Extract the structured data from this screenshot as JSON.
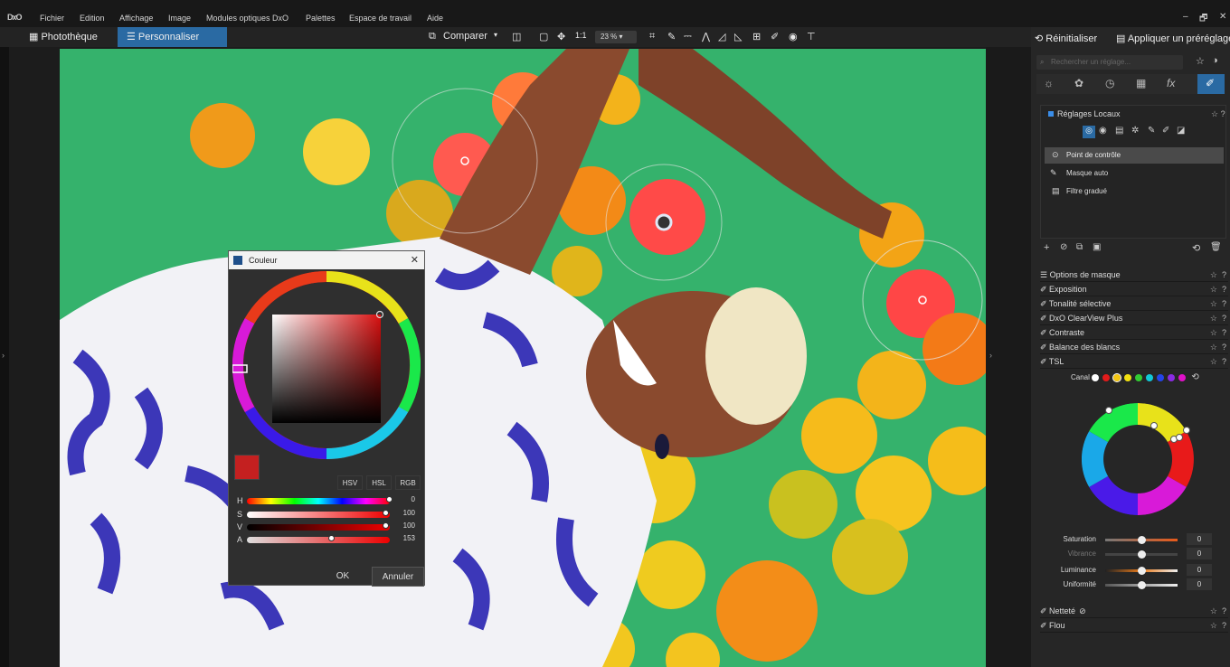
{
  "menubar": {
    "logo": "DxO",
    "items": [
      "Fichier",
      "Edition",
      "Affichage",
      "Image",
      "Modules optiques DxO",
      "Palettes",
      "Espace de travail",
      "Aide"
    ],
    "window_controls": [
      "–",
      "🗗",
      "✕"
    ]
  },
  "toolbar": {
    "tabs": [
      "Photothèque",
      "Personnaliser"
    ],
    "compare_label": "Comparer",
    "one_to_one": "1:1",
    "zoom": "23 %"
  },
  "right_panel": {
    "reset_label": "Réinitialiser",
    "apply_preset_label": "Appliquer un préréglage",
    "search_placeholder": "Rechercher un réglage...",
    "local_adjust_title": "Réglages Locaux",
    "local_tools": [
      "Point de contrôle",
      "Masque auto",
      "Filtre gradué"
    ],
    "sections": [
      "Options de masque",
      "Exposition",
      "Tonalité sélective",
      "DxO ClearView Plus",
      "Contraste",
      "Balance des blancs",
      "TSL"
    ],
    "canal_label": "Canal",
    "channel_colors": [
      "#ffffff",
      "#e21b1b",
      "#f2c511",
      "#f2e011",
      "#33cc33",
      "#11c8d8",
      "#2444e8",
      "#8a2be2",
      "#e011c8"
    ],
    "sliders": [
      {
        "label": "Saturation",
        "value": "0",
        "pos": 0.5
      },
      {
        "label": "Vibrance",
        "value": "0",
        "pos": 0.5
      },
      {
        "label": "Luminance",
        "value": "0",
        "pos": 0.5
      },
      {
        "label": "Uniformité",
        "value": "0",
        "pos": 0.5
      }
    ],
    "bottom_sections": [
      "Netteté",
      "Flou"
    ]
  },
  "color_dialog": {
    "title": "Couleur",
    "modes": [
      "HSV",
      "HSL",
      "RGB"
    ],
    "channels": [
      {
        "label": "H",
        "value": "0"
      },
      {
        "label": "S",
        "value": "100"
      },
      {
        "label": "V",
        "value": "100"
      },
      {
        "label": "A",
        "value": "153"
      }
    ],
    "ok_label": "OK",
    "cancel_label": "Annuler",
    "swatch_color": "#c42020"
  },
  "photo": {
    "background_color": "#35b26c"
  }
}
